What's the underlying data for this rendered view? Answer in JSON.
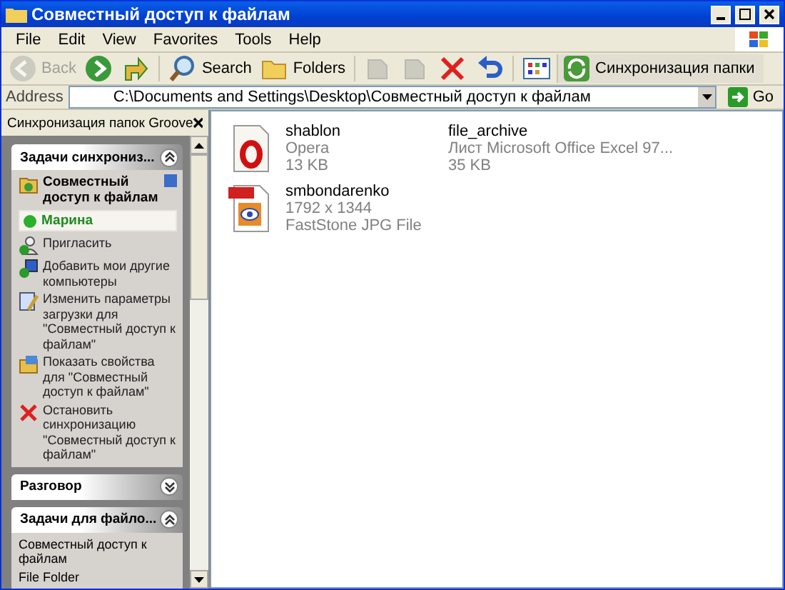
{
  "window": {
    "title": "Совместный доступ к файлам"
  },
  "menu": [
    "File",
    "Edit",
    "View",
    "Favorites",
    "Tools",
    "Help"
  ],
  "toolbar": [
    {
      "kind": "back",
      "label": "Back",
      "disabled": true
    },
    {
      "kind": "forward",
      "disabled": false
    },
    {
      "kind": "up",
      "disabled": false
    },
    {
      "kind": "search",
      "label": "Search",
      "disabled": false
    },
    {
      "kind": "folders",
      "label": "Folders",
      "disabled": false
    },
    {
      "kind": "move",
      "disabled": true
    },
    {
      "kind": "copy",
      "disabled": true
    },
    {
      "kind": "delete",
      "disabled": false
    },
    {
      "kind": "undo",
      "disabled": false
    },
    {
      "kind": "views",
      "disabled": false
    },
    {
      "kind": "sync",
      "label": "Синхронизация папки",
      "disabled": false
    }
  ],
  "address": {
    "label": "Address",
    "value": "C:\\Documents and Settings\\Desktop\\Совместный доступ к файлам",
    "go": "Go"
  },
  "side_pane": {
    "title": "Синхронизация папок Groove",
    "panels": [
      {
        "title": "Задачи синхрониз...",
        "expanded": true,
        "folder": "Совместный доступ к файлам",
        "member": "Марина",
        "tasks": [
          {
            "kind": "invite",
            "label": "Пригласить"
          },
          {
            "kind": "add",
            "label": "Добавить мои другие компьютеры"
          },
          {
            "kind": "settings",
            "label": "Изменить параметры загрузки для \"Совместный доступ к файлам\""
          },
          {
            "kind": "properties",
            "label": "Показать свойства для \"Совместный доступ к файлам\""
          },
          {
            "kind": "stop",
            "label": "Остановить синхронизацию \"Совместный доступ к файлам\""
          }
        ]
      },
      {
        "title": "Разговор",
        "expanded": false
      },
      {
        "title": "Задачи для файло...",
        "expanded": true,
        "details": [
          "Совместный доступ к файлам",
          "File Folder"
        ]
      }
    ]
  },
  "files": [
    {
      "kind": "opera",
      "name": "shablon",
      "lines": [
        "Opera",
        "13 KB"
      ]
    },
    {
      "kind": "excel",
      "name": "file_archive",
      "lines": [
        "Лист Microsoft Office Excel 97...",
        "35 KB"
      ]
    },
    {
      "kind": "jpg",
      "name": "smbondarenko",
      "lines": [
        "1792 x 1344",
        "FastStone JPG File"
      ]
    }
  ]
}
